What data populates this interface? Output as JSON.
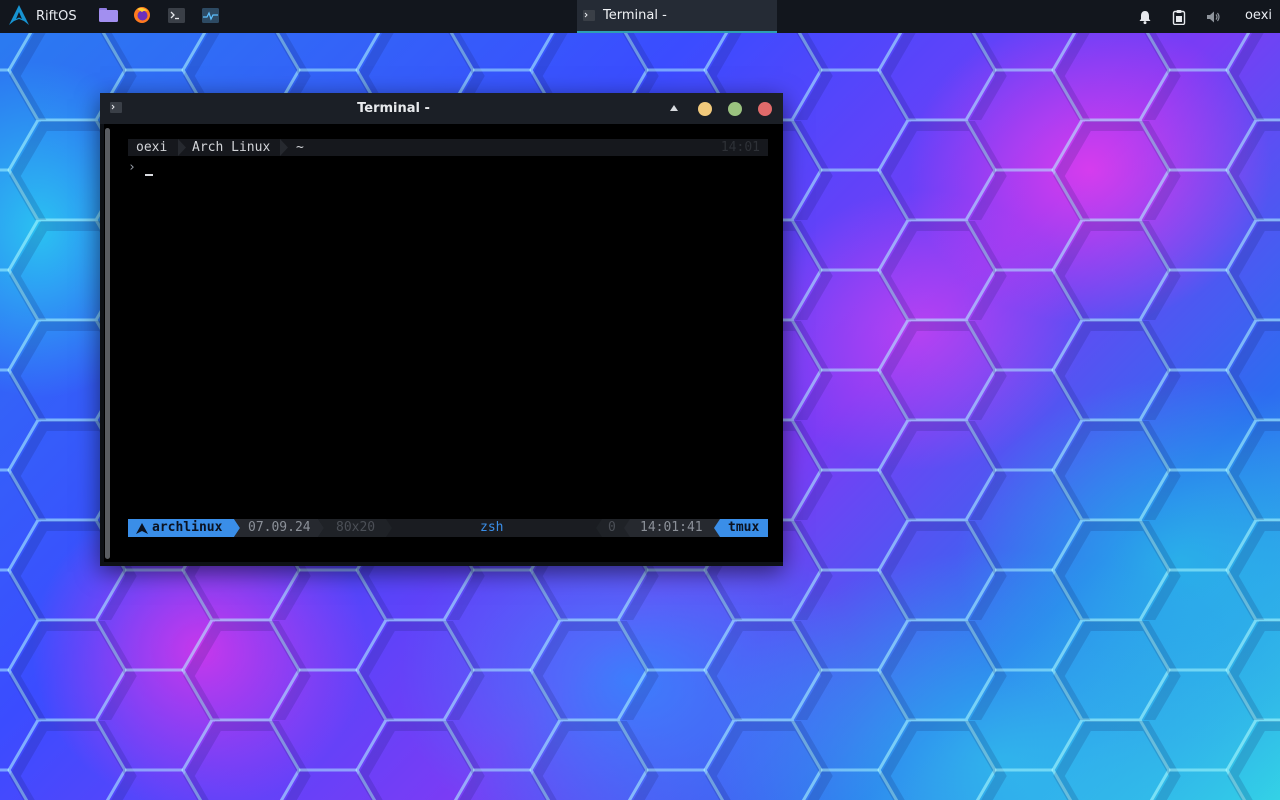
{
  "panel": {
    "launcher_label": "RiftOS",
    "launcher_icon": "arch-logo-icon",
    "pinned": [
      {
        "icon": "folder-icon",
        "name": "Files"
      },
      {
        "icon": "firefox-icon",
        "name": "Firefox"
      },
      {
        "icon": "terminal-icon",
        "name": "Terminal"
      },
      {
        "icon": "system-monitor-icon",
        "name": "System Monitor"
      }
    ],
    "task_title": "Terminal -",
    "tray": [
      "notifications-icon",
      "clipboard-icon",
      "volume-icon"
    ],
    "user": "oexi"
  },
  "window": {
    "title": "Terminal -",
    "controls": {
      "minimize_color": "#f1c97b",
      "maximize_color": "#9ac27f",
      "close_color": "#e06a6a"
    }
  },
  "terminal": {
    "prompt": {
      "user": "oexi",
      "host": "Arch Linux",
      "dir": "~",
      "time": "14:01"
    },
    "prompt_char": "›",
    "statusbar": {
      "session": "archlinux",
      "date": "07.09.24",
      "size": "80x20",
      "window": "zsh",
      "index": "0",
      "clock": "14:01:41",
      "app": "tmux"
    }
  },
  "colors": {
    "panel_bg": "#12161d",
    "accent": "#2e9fb3",
    "tmux_blue": "#3a8ee8"
  }
}
